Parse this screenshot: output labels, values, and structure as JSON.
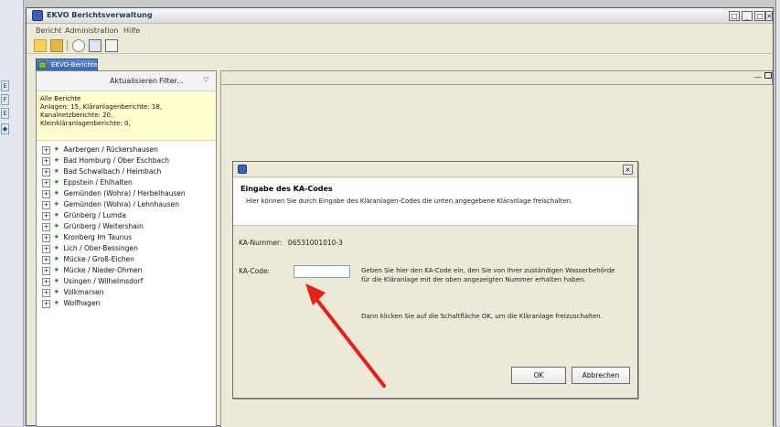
{
  "window": {
    "title": "EKVO Berichtsverwaltung"
  },
  "menubar": {
    "items": [
      "Bericht",
      "Administration",
      "Hilfe"
    ]
  },
  "left_view": {
    "tab_label": "EKVO-Berichte",
    "refresh_label": "Aktualisieren",
    "filter_label": "Filter...",
    "summary": {
      "line1": "Alle Berichte",
      "line2": "Anlagen: 15, Kläranlagenberichte: 18,",
      "line3": "Kanalnetzberichte: 20,",
      "line4": "Kleinkläranlagenberichte: 0,"
    },
    "tree": [
      "Aarbergen / Rückershausen",
      "Bad Homburg / Ober Eschbach",
      "Bad Schwalbach / Heimbach",
      "Eppstein / Ehlhalten",
      "Gemünden (Wohra) / Herbelhausen",
      "Gemünden (Wohra) / Lehnhausen",
      "Grünberg / Lumda",
      "Grünberg / Weitershain",
      "Kronberg Im Taunus",
      "Lich / Ober-Bessingen",
      "Mücke / Groß-Eichen",
      "Mücke / Nieder-Ohmen",
      "Usingen / Wilhelmsdorf",
      "Volkmarsen",
      "Wolfhagen"
    ]
  },
  "dialog": {
    "heading": "Eingabe des KA-Codes",
    "description": "Hier können Sie durch Eingabe des Kläranlagen-Codes die unten angegebene Kläranlage freischalten.",
    "ka_nummer_label": "KA-Nummer:",
    "ka_nummer_value": "06531001010-3",
    "ka_code_label": "KA-Code:",
    "ka_code_value": "",
    "hint1": "Geben Sie hier den KA-Code ein, den Sie von Ihrer zuständigen Wasserbehörde für die Kläranlage mit der oben angezeigten Nummer erhalten haben.",
    "hint2": "Dann klicken Sie auf die Schaltfläche OK, um die Kläranlage freizuschalten.",
    "ok_label": "OK",
    "cancel_label": "Abbrechen"
  },
  "annotation": {
    "arrow_color": "#e8201a"
  },
  "icons": {
    "app": "app-icon",
    "close": "close-icon",
    "minimize": "minimize-icon",
    "maximize": "maximize-icon"
  }
}
